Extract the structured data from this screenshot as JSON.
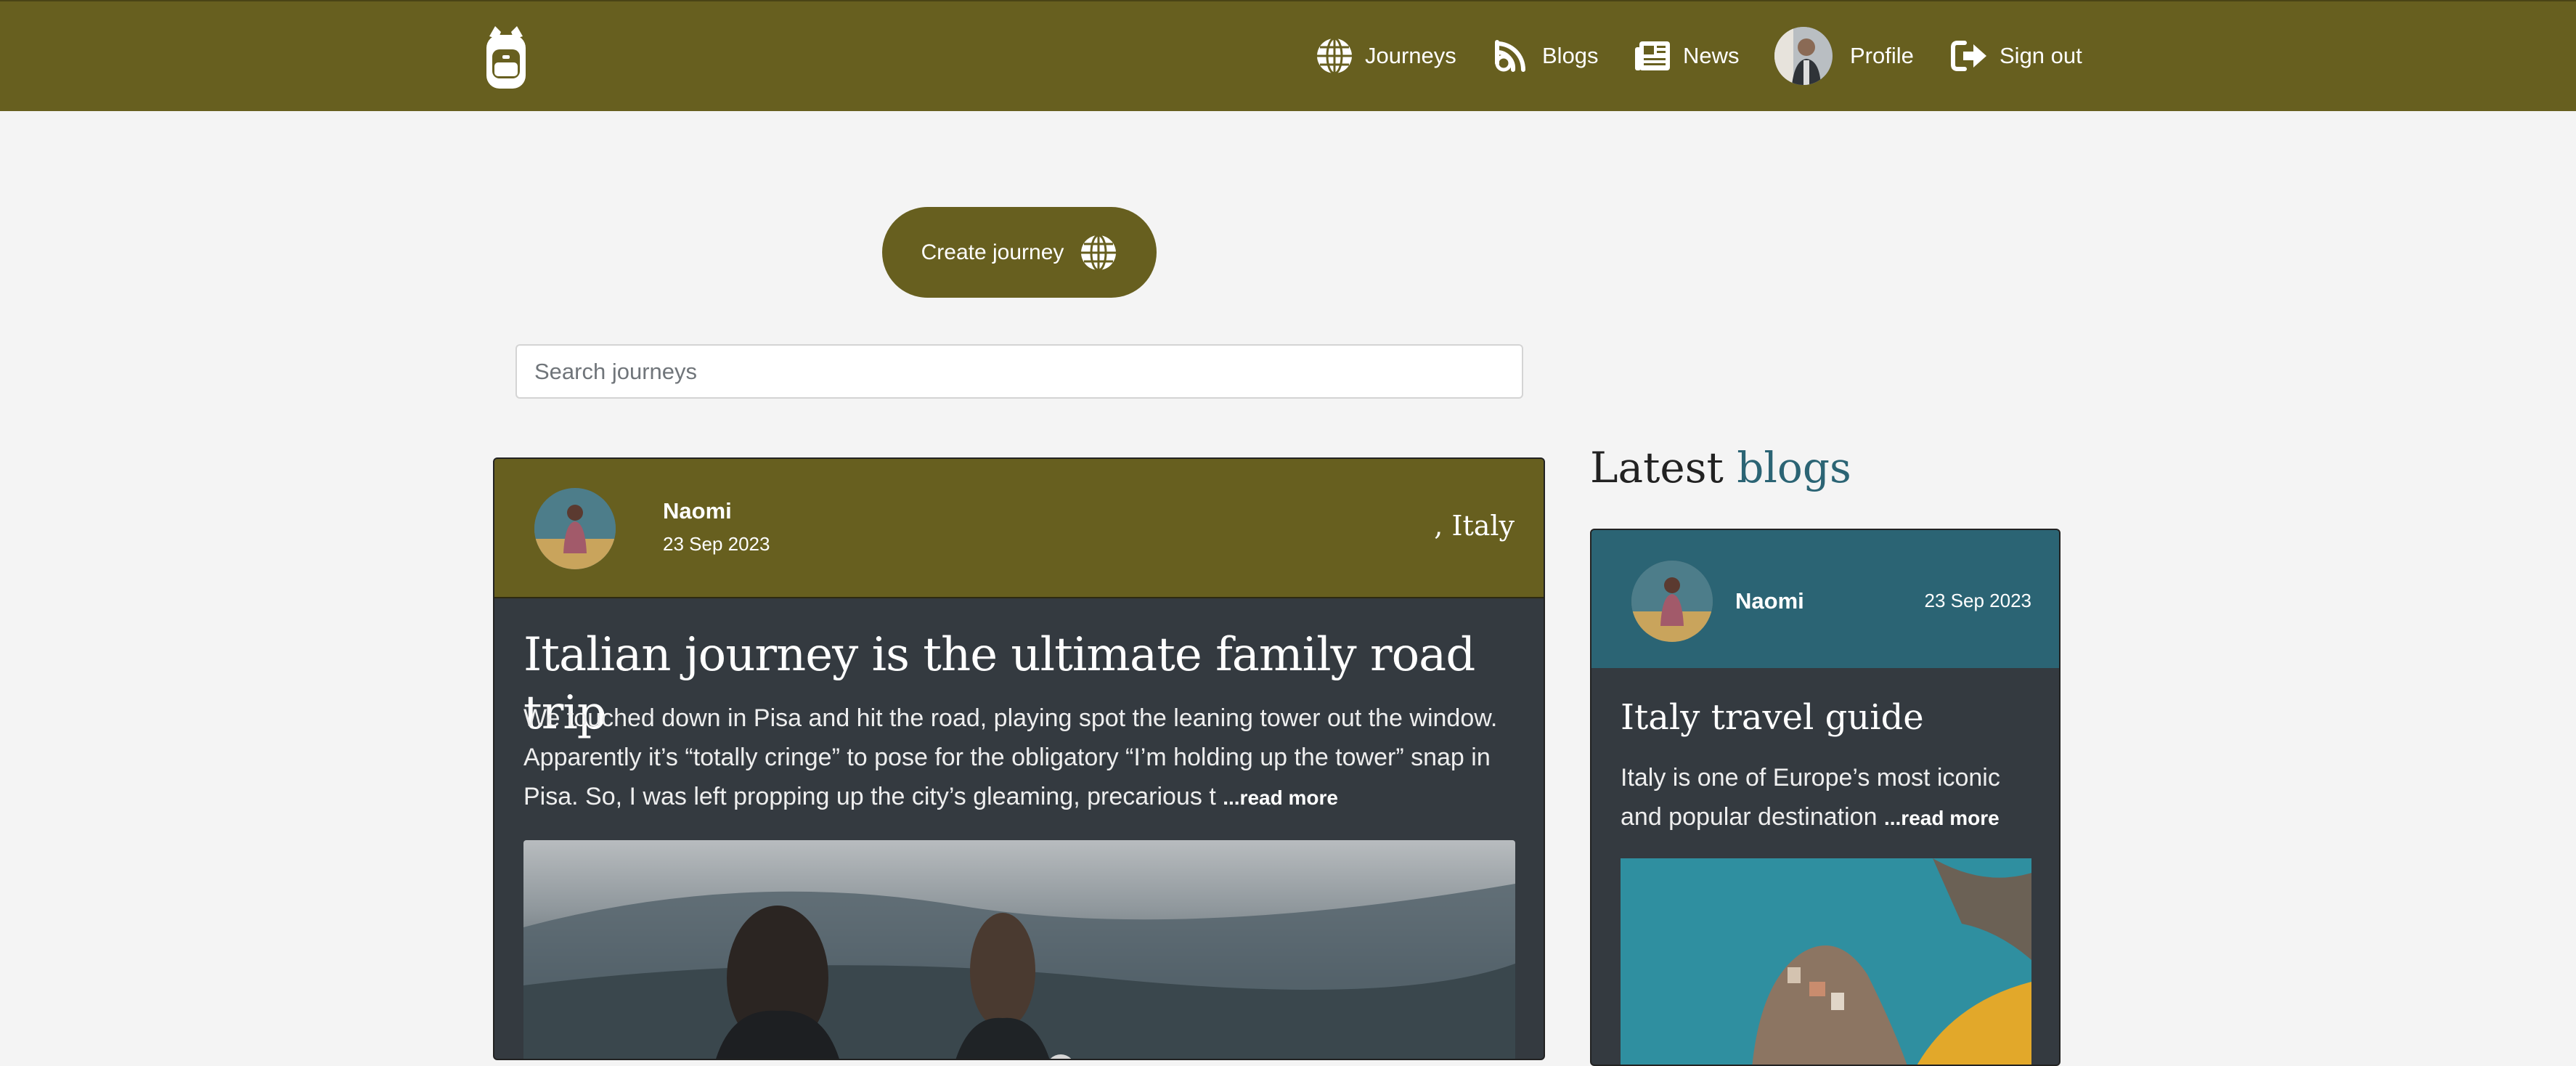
{
  "nav": {
    "items": [
      {
        "label": "Journeys",
        "icon": "globe-icon"
      },
      {
        "label": "Blogs",
        "icon": "rss-icon"
      },
      {
        "label": "News",
        "icon": "newspaper-icon"
      },
      {
        "label": "Profile",
        "icon": "avatar"
      },
      {
        "label": "Sign out",
        "icon": "sign-out-icon"
      }
    ],
    "logo": "backpack-icon"
  },
  "actions": {
    "create_journey_label": "Create journey"
  },
  "search": {
    "placeholder": "Search journeys"
  },
  "journey": {
    "author": "Naomi",
    "date": "23 Sep 2023",
    "location": ", Italy",
    "title": "Italian journey is the ultimate family road trip",
    "excerpt": "We touched down in Pisa and hit the road, playing spot the leaning tower out the window. Apparently it’s “totally cringe” to pose for the obligatory “I’m holding up the tower” snap in Pisa. So, I was left propping up the city’s gleaming, precarious t ",
    "read_more": "...read more"
  },
  "latest_blogs": {
    "heading_main": "Latest",
    "heading_accent": "blogs",
    "card": {
      "author": "Naomi",
      "date": "23 Sep 2023",
      "title": "Italy travel guide",
      "excerpt": "Italy is one of Europe’s most iconic and popular destination ",
      "read_more": "...read more"
    }
  },
  "colors": {
    "primary": "#675f1f",
    "blog_header": "#2b6474",
    "card_bg": "#343a40",
    "page_bg": "#f4f4f4"
  }
}
